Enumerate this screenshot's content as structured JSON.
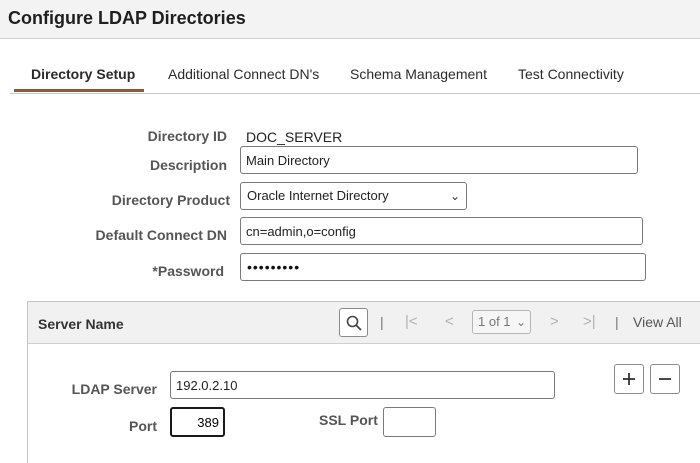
{
  "header": {
    "title": "Configure LDAP Directories"
  },
  "tabs": [
    {
      "label": "Directory Setup"
    },
    {
      "label": "Additional Connect DN's"
    },
    {
      "label": "Schema Management"
    },
    {
      "label": "Test Connectivity"
    }
  ],
  "form": {
    "directory_id_label": "Directory ID",
    "directory_id_value": "DOC_SERVER",
    "description_label": "Description",
    "description_value": "Main Directory",
    "product_label": "Directory Product",
    "product_value": "Oracle Internet Directory",
    "connect_dn_label": "Default Connect DN",
    "connect_dn_value": "cn=admin,o=config",
    "password_label": "*Password",
    "password_mask": "•••••••••"
  },
  "grid": {
    "title": "Server Name",
    "pager": "1 of 1",
    "view_all": "View All",
    "ldap_server_label": "LDAP Server",
    "ldap_server_value": "192.0.2.10",
    "port_label": "Port",
    "port_value": "389",
    "ssl_port_label": "SSL Port",
    "ssl_port_value": ""
  },
  "colors": {
    "tab_accent": "#8b5a3c",
    "header_bg": "#f3f3f3"
  }
}
